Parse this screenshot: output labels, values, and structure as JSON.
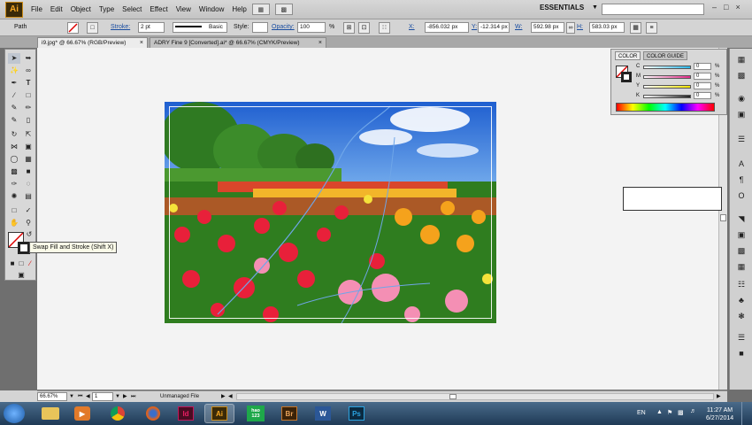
{
  "app": {
    "logo": "Ai",
    "workspace": "ESSENTIALS"
  },
  "menu": [
    "File",
    "Edit",
    "Object",
    "Type",
    "Select",
    "Effect",
    "View",
    "Window",
    "Help"
  ],
  "window_controls": [
    "–",
    "□",
    "×"
  ],
  "control_bar": {
    "selection_type": "Path",
    "stroke_label": "Stroke:",
    "stroke_weight": "2 pt",
    "profile": "Basic",
    "style_label": "Style:",
    "opacity_label": "Opacity:",
    "opacity_value": "100",
    "opacity_unit": "%",
    "x_label": "X:",
    "x_value": "-856.032 px",
    "y_label": "Y:",
    "y_value": "-12.314 px",
    "w_label": "W:",
    "w_value": "592.98 px",
    "h_label": "H:",
    "h_value": "583.03 px"
  },
  "tabs": [
    {
      "label": "i9.jpg* @ 66.67% (RGB/Preview)",
      "close": "×"
    },
    {
      "label": "ADRY Fine 9 [Converted].ai* @ 66.67% (CMYK/Preview)",
      "close": "×"
    }
  ],
  "tooltip": "Swap Fill and Stroke (Shift X)",
  "color_panel": {
    "tabs": [
      "COLOR",
      "COLOR GUIDE"
    ],
    "channels": [
      {
        "label": "C",
        "value": "0",
        "unit": "%",
        "color": "#29b6e8"
      },
      {
        "label": "M",
        "value": "0",
        "unit": "%",
        "color": "#e52b8a"
      },
      {
        "label": "Y",
        "value": "0",
        "unit": "%",
        "color": "#f2e400"
      },
      {
        "label": "K",
        "value": "0",
        "unit": "%",
        "color": "#222222"
      }
    ]
  },
  "status_bar": {
    "zoom": "66.67%",
    "artboard": "1",
    "status": "Unmanaged File"
  },
  "taskbar": {
    "apps": [
      {
        "name": "explorer",
        "label": "",
        "color": "#e8c45a"
      },
      {
        "name": "media",
        "label": "▶",
        "color": "#e27a2a"
      },
      {
        "name": "chrome",
        "label": "",
        "color": "#3a9a3a"
      },
      {
        "name": "firefox",
        "label": "",
        "color": "#e0621c"
      },
      {
        "name": "indesign",
        "label": "Id",
        "color": "#c2185b"
      },
      {
        "name": "illustrator",
        "label": "Ai",
        "color": "#f5a623"
      },
      {
        "name": "hao123",
        "label": "hao 123",
        "color": "#1ea84a"
      },
      {
        "name": "bridge",
        "label": "Br",
        "color": "#c6762a"
      },
      {
        "name": "word",
        "label": "W",
        "color": "#2b5797"
      },
      {
        "name": "photoshop",
        "label": "Ps",
        "color": "#2ba3e0"
      }
    ],
    "language": "EN",
    "time": "11:27 AM",
    "date": "6/27/2014"
  }
}
